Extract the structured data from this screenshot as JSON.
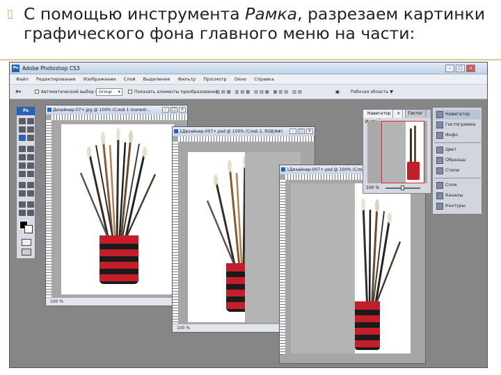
{
  "slide": {
    "bullet": "▯",
    "text_before": "С помощью инструмента ",
    "text_italic": "Рамка",
    "text_after": ", разрезаем картинки графического фона главного меню на части:"
  },
  "app": {
    "title": "Adobe Photoshop CS3",
    "logo": "Ps",
    "win_controls": [
      "–",
      "□",
      "×"
    ],
    "menu": [
      "Файл",
      "Редактирование",
      "Изображение",
      "Слой",
      "Выделение",
      "Фильтр",
      "Просмотр",
      "Окно",
      "Справка"
    ],
    "options": {
      "autoselect_label": "Автоматический выбор слоя",
      "autoselect_value": "Group",
      "show_transform_label": "Показать элементы преобразования",
      "workspace_label": "Рабочая область ▼"
    }
  },
  "documents": [
    {
      "title": "Дизайнер-07+.jpg @ 100% (Слой 1 (копия)...",
      "zoom": "100 %"
    },
    {
      "title": "2Дизайнер-007+.psd @ 100% (Слой 2, RGB/8#)",
      "zoom": "100 %"
    },
    {
      "title": "1Дизайнер-007+.psd @ 100% (Слой",
      "zoom": "100 %"
    }
  ],
  "navigator": {
    "tabs": [
      "Навигатор",
      "×",
      "Гистог",
      "Инфо"
    ],
    "zoom": "100 %"
  },
  "dock": {
    "items": [
      "Навигатор",
      "Гистограмма",
      "Инфо",
      "Цвет",
      "Образцы",
      "Стили",
      "Слои",
      "Каналы",
      "Контуры"
    ]
  },
  "colors": {
    "accent": "#2a62b8",
    "cup_red": "#c41e2a",
    "cup_black": "#1b1b1b",
    "rule": "#e2c99a"
  }
}
